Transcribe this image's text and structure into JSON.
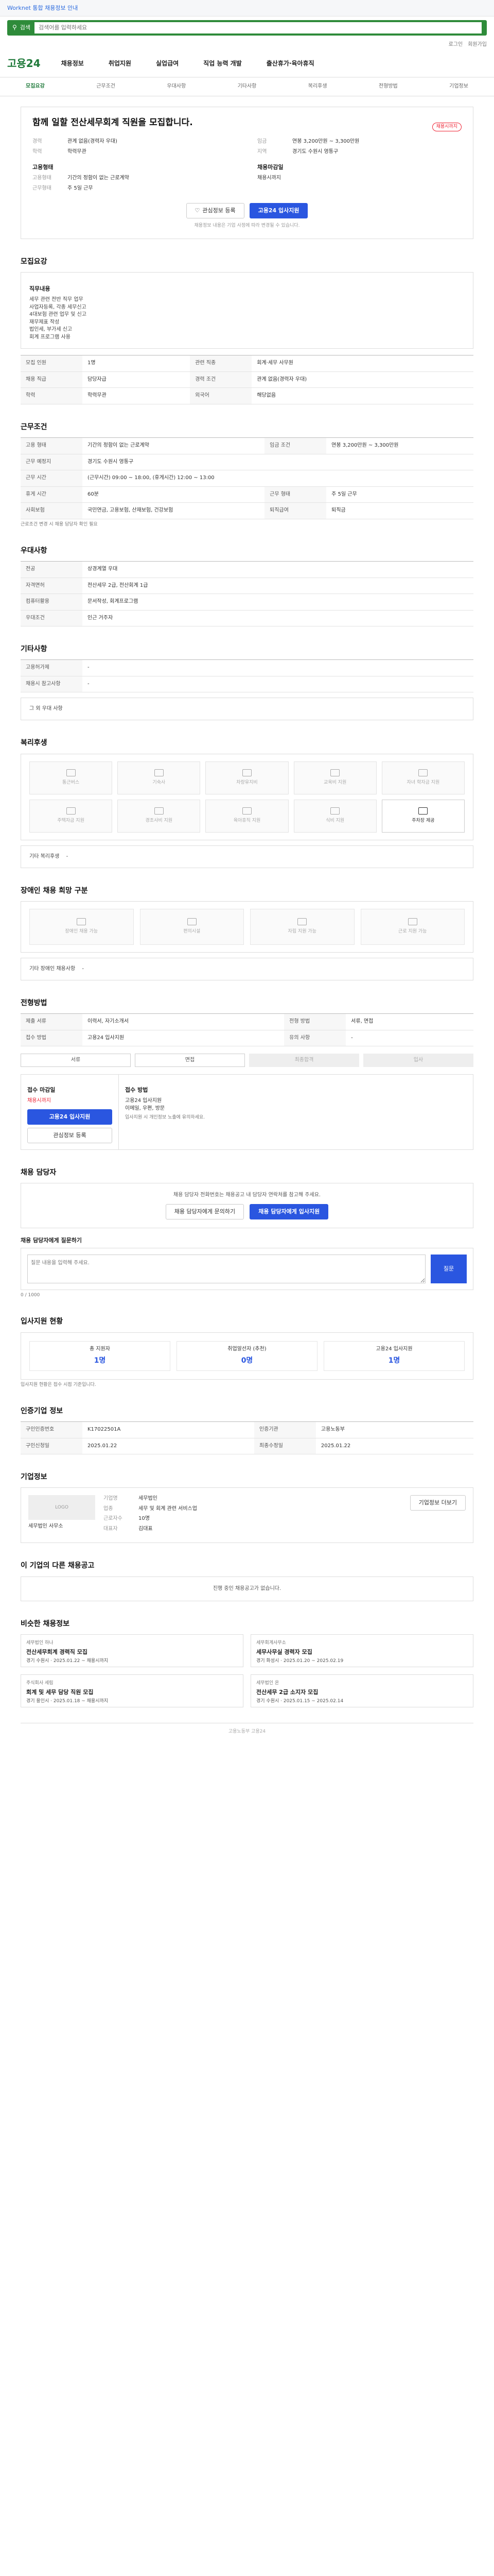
{
  "topbar": {
    "text": "Worknet 통합 채용정보 안내"
  },
  "search": {
    "label": "검색",
    "placeholder": "검색어를 입력하세요"
  },
  "util": [
    "로그인",
    "회원가입"
  ],
  "gnb": {
    "logo": "고용24",
    "menu": [
      "채용정보",
      "취업지원",
      "실업급여",
      "직업 능력 개발",
      "출산휴가·육아휴직"
    ]
  },
  "anchors": [
    "모집요강",
    "근무조건",
    "우대사항",
    "기타사항",
    "복리후생",
    "전형방법",
    "기업정보"
  ],
  "header": {
    "title": "함께 일할 전산세무회계 직원을 모집합니다.",
    "badge": "채용시까지",
    "left": [
      {
        "k": "경력",
        "v": "관계 없음(경력자 우대)"
      },
      {
        "k": "학력",
        "v": "학력무관"
      }
    ],
    "right": [
      {
        "k": "임금",
        "v": "연봉 3,200만원 ~ 3,300만원"
      },
      {
        "k": "지역",
        "v": "경기도 수원시 영통구"
      }
    ],
    "emp_label": "고용형태",
    "emp": [
      {
        "k": "고용형태",
        "v": "기간의 정함이 없는 근로계약"
      },
      {
        "k": "근무형태",
        "v": "주 5일 근무"
      }
    ],
    "due_label": "채용마감일",
    "due": "채용시까지",
    "scrap": "관심정보 등록",
    "apply": "고용24 입사지원",
    "note": "채용정보 내용은 기업 사정에 따라 변경될 수 있습니다."
  },
  "sections": {
    "recruit": "모집요강",
    "cond": "근무조건",
    "pref": "우대사항",
    "etc": "기타사항",
    "benefit": "복리후생",
    "disabled": "장애인 채용 희망 구분",
    "process": "전형방법",
    "contact": "채용 담당자",
    "status": "입사지원 현황",
    "info": "인증기업 정보",
    "company": "기업정보",
    "other": "이 기업의 다른 채용공고",
    "similar": "비슷한 채용정보"
  },
  "recruit": {
    "duty_label": "직무내용",
    "duty": [
      "세무 관련 전반 직무 업무",
      "사업자등록, 각종 세무신고",
      "4대보험 관련 업무 및 신고",
      "재무제표 작성",
      "법인세, 부가세 신고",
      "회계 프로그램 사용"
    ],
    "rows": [
      {
        "k": "모집 인원",
        "v": "1명"
      },
      {
        "k": "관련 직종",
        "v": "회계·세무 사무원"
      },
      {
        "k": "채용 직급",
        "v": "담당자급"
      },
      {
        "k": "경력 조건",
        "v": "관계 없음(경력자 우대)"
      },
      {
        "k": "학력",
        "v": "학력무관"
      },
      {
        "k": "외국어",
        "v": "해당없음"
      }
    ]
  },
  "cond": {
    "rows": [
      {
        "k": "고용 형태",
        "v": "기간의 정함이 없는 근로계약"
      },
      {
        "k": "임금 조건",
        "v": "연봉 3,200만원 ~ 3,300만원"
      },
      {
        "k": "근무 예정지",
        "v": "경기도 수원시 영통구"
      },
      {
        "k": "근무 시간",
        "v": "(근무시간) 09:00 ~ 18:00, (휴게시간) 12:00 ~ 13:00"
      },
      {
        "k": "휴게 시간",
        "v": "60분"
      },
      {
        "k": "근무 형태",
        "v": "주 5일 근무"
      },
      {
        "k": "사회보험",
        "v": "국민연금, 고용보험, 산재보험, 건강보험"
      },
      {
        "k": "퇴직급여",
        "v": "퇴직금"
      }
    ],
    "note": "근로조건 변경 시 채용 담당자 확인 필요"
  },
  "pref": {
    "rows": [
      {
        "k": "전공",
        "v": "상경계열 우대"
      },
      {
        "k": "자격면허",
        "v": "전산세무 2급, 전산회계 1급"
      },
      {
        "k": "컴퓨터활용",
        "v": "문서작성, 회계프로그램"
      },
      {
        "k": "우대조건",
        "v": "인근 거주자"
      }
    ]
  },
  "etc": {
    "rows": [
      {
        "k": "고용허가제",
        "v": "-"
      },
      {
        "k": "채용시 참고사항",
        "v": "-"
      }
    ],
    "more_label": "그 외 우대 사항"
  },
  "benefit": {
    "tiles": [
      "통근버스",
      "기숙사",
      "차량유지비",
      "교육비 지원",
      "자녀 학자금 지원",
      "주택자금 지원",
      "경조사비 지원",
      "육아휴직 지원",
      "식비 지원",
      "주차장 제공"
    ],
    "on_index": 9,
    "other_label": "기타 복리후생",
    "other": "-"
  },
  "disabled": {
    "tiles": [
      "장애인 채용 가능",
      "편의시설",
      "자립 지원 가능",
      "근로 지원 가능"
    ],
    "more_label": "기타 장애인 채용사항",
    "more": "-"
  },
  "process": {
    "rows": [
      {
        "k": "제출 서류",
        "v": "이력서, 자기소개서"
      },
      {
        "k": "전형 방법",
        "v": "서류, 면접"
      },
      {
        "k": "접수 방법",
        "v": "고용24 입사지원"
      },
      {
        "k": "유의 사항",
        "v": "-"
      }
    ],
    "steps": [
      "서류",
      "면접",
      "최종합격",
      "입사"
    ]
  },
  "apply": {
    "l_title": "접수 마감일",
    "l_date": "채용시까지",
    "btn": "고용24 입사지원",
    "scrap": "관심정보 등록",
    "r_title": "접수 방법",
    "r_lines": [
      "고용24 입사지원",
      "이메일, 우편, 방문"
    ],
    "warn": "입사지원 시 개인정보 노출에 유의하세요."
  },
  "contact": {
    "q": "채용 담당자 전화번호는 채용공고 내 담당자 연락처를 참고해 주세요.",
    "b1": "채용 담당자에게 문의하기",
    "b2": "채용 담당자에게 입사지원"
  },
  "inquiry": {
    "title": "채용 담당자에게 질문하기",
    "placeholder": "질문 내용을 입력해 주세요.",
    "send": "질문",
    "count": "0 / 1000"
  },
  "status": {
    "items": [
      {
        "k": "총 지원자",
        "v": "1명"
      },
      {
        "k": "취업알선자 (추천)",
        "v": "0명"
      },
      {
        "k": "고용24 입사지원",
        "v": "1명"
      }
    ],
    "note": "입사지원 현황은 접수 시점 기준입니다."
  },
  "info": {
    "rows": [
      {
        "k": "구인인증번호",
        "v": "K17022501A"
      },
      {
        "k": "인증기관",
        "v": "고용노동부"
      },
      {
        "k": "구인신청일",
        "v": "2025.01.22"
      },
      {
        "k": "최종수정일",
        "v": "2025.01.22"
      }
    ]
  },
  "company": {
    "logo": "LOGO",
    "name": "세무법인 사무소",
    "rows": [
      {
        "k": "기업명",
        "v": "세무법인"
      },
      {
        "k": "업종",
        "v": "세무 및 회계 관련 서비스업"
      },
      {
        "k": "근로자수",
        "v": "10명"
      },
      {
        "k": "대표자",
        "v": "김대표"
      }
    ],
    "btn": "기업정보 더보기"
  },
  "other": {
    "empty": "진행 중인 채용공고가 없습니다."
  },
  "similar": [
    {
      "co": "세무법인 하나",
      "title": "전산세무회계 경력직 모집",
      "meta": "경기 수원시",
      "date": "2025.01.22 ~ 채용시까지"
    },
    {
      "co": "세무회계사무소",
      "title": "세무사무실 경력자 모집",
      "meta": "경기 화성시",
      "date": "2025.01.20 ~ 2025.02.19"
    },
    {
      "co": "주식회사 세림",
      "title": "회계 및 세무 담당 직원 모집",
      "meta": "경기 용인시",
      "date": "2025.01.18 ~ 채용시까지"
    },
    {
      "co": "세무법인 온",
      "title": "전산세무 2급 소지자 모집",
      "meta": "경기 수원시",
      "date": "2025.01.15 ~ 2025.02.14"
    }
  ],
  "footer": "고용노동부 고용24"
}
